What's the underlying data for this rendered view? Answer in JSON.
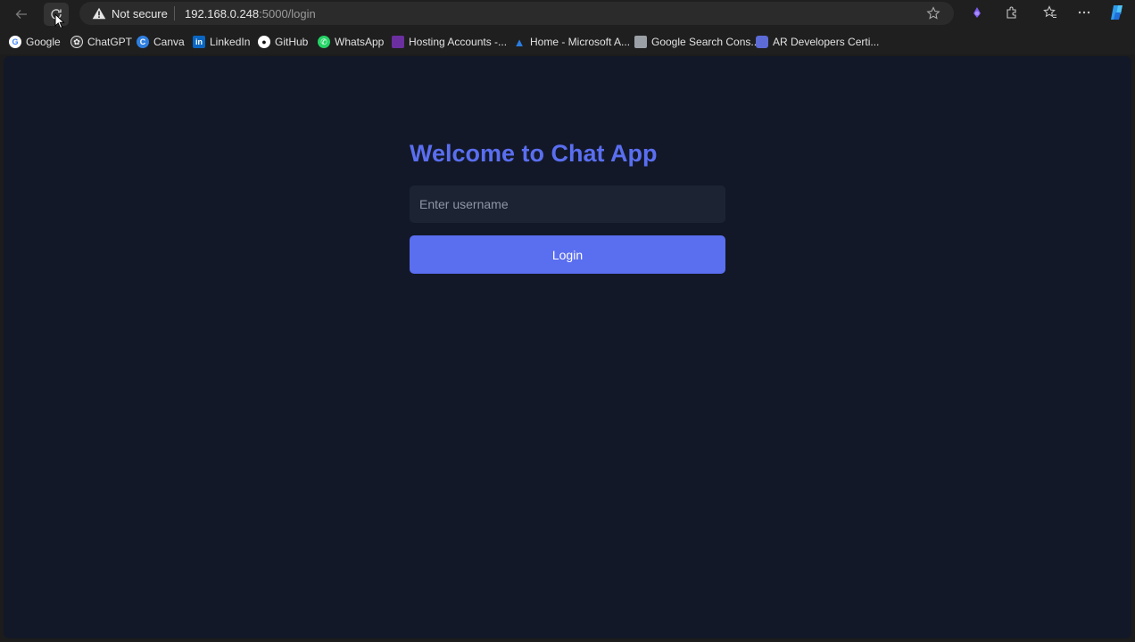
{
  "browser": {
    "security_label": "Not secure",
    "url_host": "192.168.0.248",
    "url_rest": ":5000/login",
    "icons": [
      "back-arrow-icon",
      "reload-icon",
      "warning-icon",
      "star-icon",
      "copilot-gem-icon",
      "extensions-icon",
      "favorites-icon",
      "more-icon",
      "copilot-icon"
    ]
  },
  "bookmarks": [
    {
      "label": "Google",
      "icon": "google-icon",
      "color": "#ffffff"
    },
    {
      "label": "ChatGPT",
      "icon": "chatgpt-icon",
      "color": "#3a3a3a"
    },
    {
      "label": "Canva",
      "icon": "canva-icon",
      "color": "#2f7fe0"
    },
    {
      "label": "LinkedIn",
      "icon": "linkedin-icon",
      "color": "#0a66c2"
    },
    {
      "label": "GitHub",
      "icon": "github-icon",
      "color": "#ffffff"
    },
    {
      "label": "WhatsApp",
      "icon": "whatsapp-icon",
      "color": "#25d366"
    },
    {
      "label": "Hosting Accounts -...",
      "icon": "hosting-icon",
      "color": "#6b2fa0"
    },
    {
      "label": "Home - Microsoft A...",
      "icon": "azure-icon",
      "color": "#2a7de1"
    },
    {
      "label": "Google Search Cons...",
      "icon": "search-console-icon",
      "color": "#9aa0a6"
    },
    {
      "label": "AR Developers Certi...",
      "icon": "ar-dev-icon",
      "color": "#5c6bd6"
    }
  ],
  "login": {
    "title": "Welcome to Chat App",
    "username_placeholder": "Enter username",
    "username_value": "",
    "login_label": "Login"
  },
  "colors": {
    "page_bg": "#121827",
    "accent": "#5a6ef0",
    "input_bg": "#1c2333"
  }
}
